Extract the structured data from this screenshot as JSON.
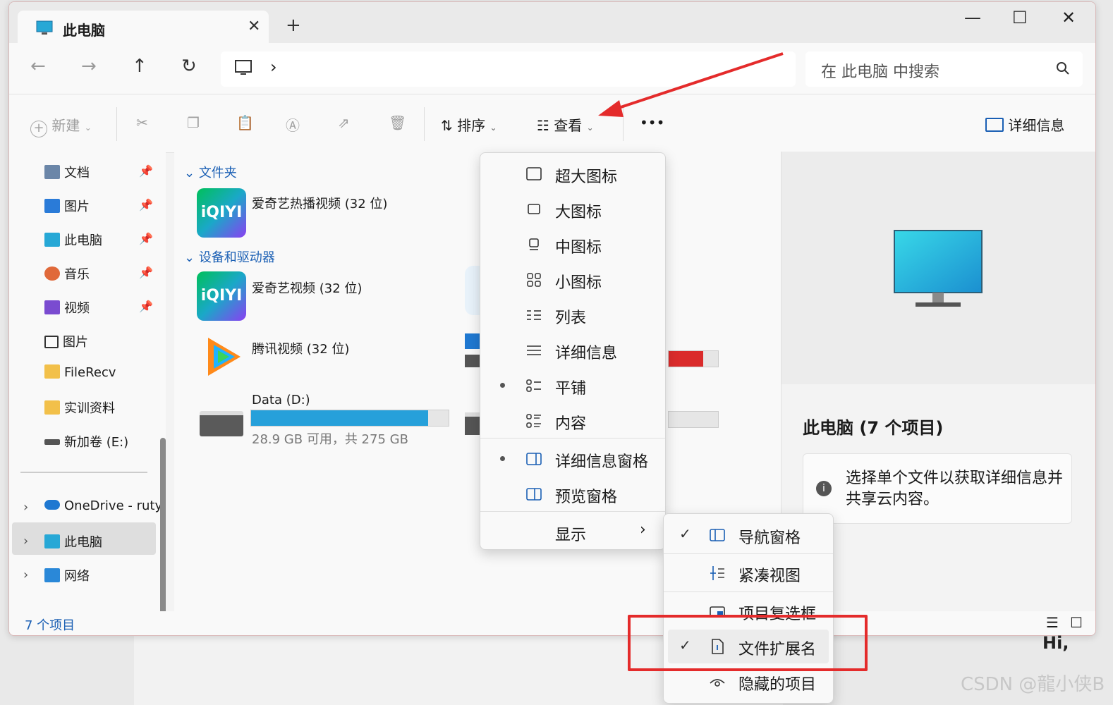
{
  "window": {
    "tab_title": "此电脑",
    "tab_close": "✕",
    "new_tab": "+",
    "minimize": "—",
    "maximize": "☐",
    "close": "✕"
  },
  "nav": {
    "back": "←",
    "forward": "→",
    "up": "↑",
    "refresh": "↻",
    "address_chevron": "›",
    "search_placeholder": "在 此电脑 中搜索"
  },
  "toolbar": {
    "new": "新建",
    "sort": "排序",
    "view": "查看",
    "more": "•••",
    "details": "详细信息"
  },
  "sidebar": {
    "items": [
      {
        "label": "文档",
        "color": "#6b86a8"
      },
      {
        "label": "图片",
        "color": "#2a7bd8"
      },
      {
        "label": "此电脑",
        "color": "#27a8d6"
      },
      {
        "label": "音乐",
        "color": "#e0693a"
      },
      {
        "label": "视频",
        "color": "#7a4bd0"
      },
      {
        "label": "图片",
        "color": "#ffffff"
      },
      {
        "label": "FileRecv",
        "color": "#f2c04a"
      },
      {
        "label": "实训资料",
        "color": "#f2c04a"
      },
      {
        "label": "新加卷 (E:)",
        "color": "#555555"
      }
    ],
    "roots": [
      {
        "label": "OneDrive - ruty",
        "color": "#1f78d1"
      },
      {
        "label": "此电脑",
        "color": "#27a8d6"
      },
      {
        "label": "网络",
        "color": "#2a88d8"
      }
    ]
  },
  "content": {
    "group_folders": "文件夹",
    "group_devices": "设备和驱动器",
    "apps": [
      {
        "name": "爱奇艺热播视频 (32 位)",
        "logo": "iQIYI"
      },
      {
        "name": "爱奇艺视频 (32 位)",
        "logo": "iQIYI"
      },
      {
        "name": "腾讯视频 (32 位)"
      }
    ],
    "drive": {
      "name": "Data (D:)",
      "free": "28.9 GB 可用，共 275 GB",
      "used_fraction": 0.895
    }
  },
  "detail_pane": {
    "title": "此电脑 (7 个项目)",
    "info": "选择单个文件以获取详细信息并共享云内容。"
  },
  "status": {
    "count": "7 个项目"
  },
  "view_menu": {
    "items": [
      "超大图标",
      "大图标",
      "中图标",
      "小图标",
      "列表",
      "详细信息",
      "平铺",
      "内容"
    ],
    "panes": [
      "详细信息窗格",
      "预览窗格"
    ],
    "show": "显示",
    "show_arrow": "›"
  },
  "show_menu": {
    "items": [
      "导航窗格",
      "紧凑视图",
      "项目复选框",
      "文件扩展名",
      "隐藏的项目"
    ],
    "check": "✓"
  },
  "overlay": {
    "hi": "Hi,",
    "watermark": "CSDN @龍小侠B"
  }
}
